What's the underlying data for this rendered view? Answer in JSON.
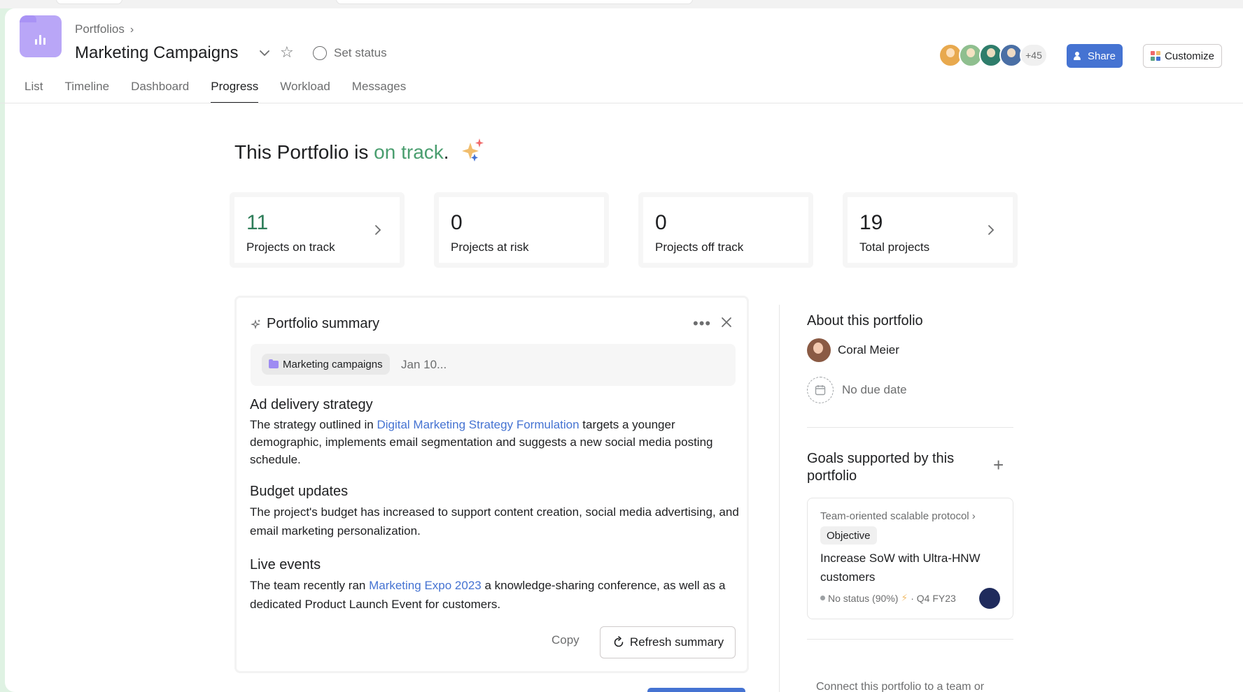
{
  "header": {
    "breadcrumb": "Portfolios",
    "title": "Marketing Campaigns",
    "set_status": "Set status",
    "members_more": "+45",
    "share_label": "Share",
    "customize_label": "Customize",
    "avatar_colors": [
      "#e8a94e",
      "#8fbf8f",
      "#2f7d6b",
      "#4a6fa5"
    ]
  },
  "tabs": [
    "List",
    "Timeline",
    "Dashboard",
    "Progress",
    "Workload",
    "Messages"
  ],
  "active_tab": "Progress",
  "headline": {
    "prefix": "This Portfolio is ",
    "status": "on track",
    "suffix": "."
  },
  "stats": [
    {
      "value": "11",
      "label": "Projects on track"
    },
    {
      "value": "0",
      "label": "Projects at risk"
    },
    {
      "value": "0",
      "label": "Projects off track"
    },
    {
      "value": "19",
      "label": "Total projects"
    }
  ],
  "summary": {
    "title": "Portfolio summary",
    "chip_label": "Marketing campaigns",
    "date": "Jan 10...",
    "sections": [
      {
        "heading": "Ad delivery strategy",
        "text_before": "The strategy outlined in ",
        "link": "Digital Marketing Strategy Formulation",
        "text_after": " targets a younger demographic, implements email segmentation and suggests a new social media posting schedule."
      },
      {
        "heading": "Budget updates",
        "text": "The project's budget has increased to support content creation, social media advertising, and email marketing personalization."
      },
      {
        "heading": "Live events",
        "text_before": "The team recently ran ",
        "link": "Marketing Expo 2023",
        "text_after": " a knowledge-sharing conference, as well as a dedicated Product Launch Event for customers."
      }
    ],
    "copy_label": "Copy",
    "refresh_label": "Refresh summary"
  },
  "about": {
    "title": "About this portfolio",
    "owner": "Coral Meier",
    "due": "No due date",
    "goals_title": "Goals supported by this portfolio",
    "goal": {
      "parent": "Team-oriented scalable protocol",
      "type": "Objective",
      "name": "Increase SoW with Ultra-HNW customers",
      "status": "No status (90%)",
      "period": "· Q4 FY23"
    },
    "connect_text": "Connect this portfolio to a team or"
  },
  "colors": {
    "accent": "#4573d2",
    "on_track": "#4a9e6f"
  }
}
